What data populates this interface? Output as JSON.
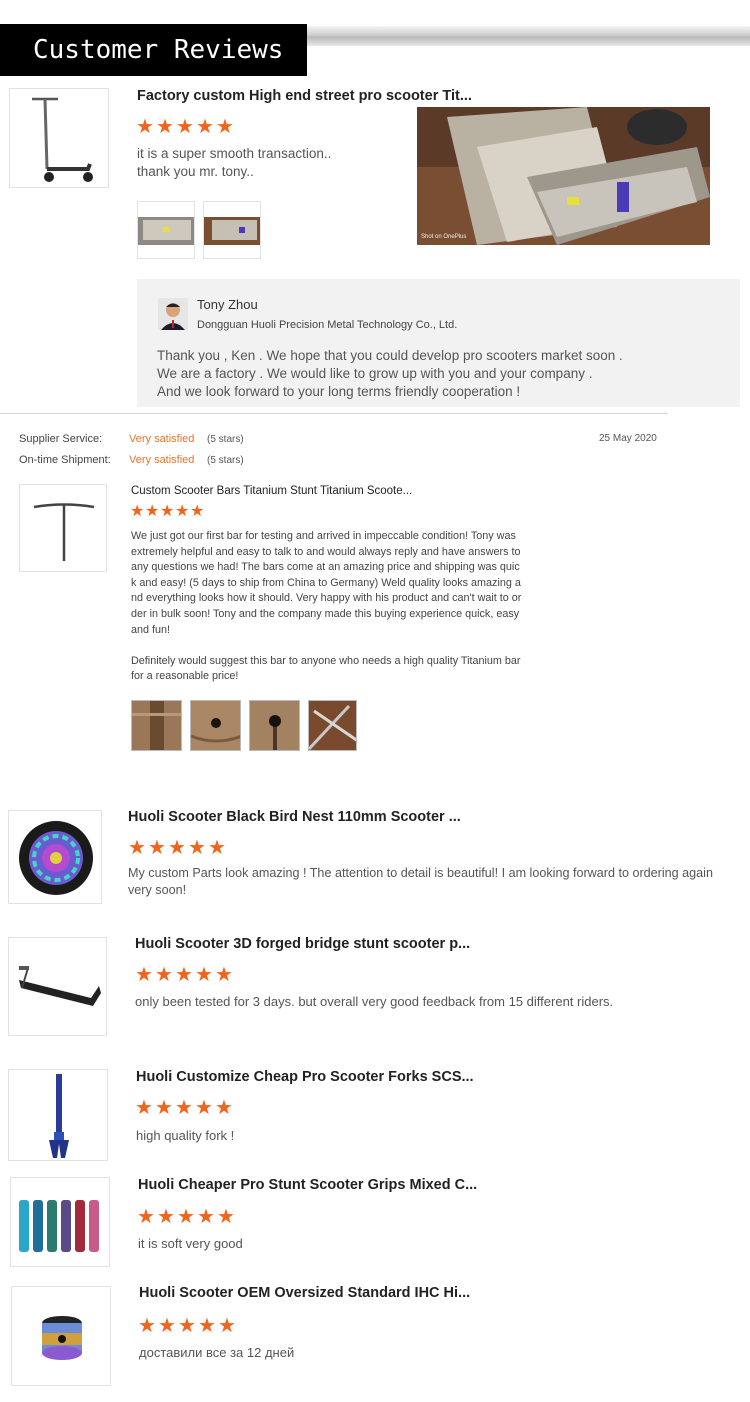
{
  "header": {
    "title": "Customer Reviews"
  },
  "review1": {
    "title": "Factory custom High end street pro scooter Tit...",
    "stars": 5,
    "text_line1": "it is a super smooth transaction..",
    "text_line2": "thank you mr. tony..",
    "photo_watermark": "Shot on OnePlus",
    "reply": {
      "name": "Tony Zhou",
      "company": "Dongguan Huoli Precision Metal Technology Co., Ltd.",
      "line1": "Thank you , Ken . We hope that you could develop pro scooters market soon .",
      "line2": "We are a factory . We would like to grow up with you and your company .",
      "line3": "And we look forward to your long terms friendly cooperation !"
    }
  },
  "review2": {
    "supplier_label": "Supplier Service:",
    "supplier_value": "Very satisfied",
    "supplier_stars": "(5 stars)",
    "shipment_label": "On-time Shipment:",
    "shipment_value": "Very satisfied",
    "shipment_stars": "(5 stars)",
    "date": "25 May 2020",
    "title": "Custom Scooter Bars Titanium Stunt Titanium Scoote...",
    "stars": 5,
    "lines": [
      "We just got our first bar for testing and arrived in impeccable condition! Tony was",
      "extremely helpful and easy to talk to and would always reply and have answers to",
      "any questions we had! The bars come at an amazing price and shipping was quic",
      "k and easy! (5 days to ship from China to Germany) Weld quality looks amazing a",
      "nd everything looks how it should. Very happy with his product and can't wait to or",
      "der in bulk soon! Tony and the company made this buying experience quick, easy",
      "and fun!"
    ],
    "lines2": [
      "Definitely would suggest this bar to anyone who needs a high quality Titanium bar",
      "for a reasonable price!"
    ]
  },
  "review3": {
    "title": "Huoli Scooter Black Bird Nest 110mm Scooter ...",
    "stars": 5,
    "line1": "My custom Parts look amazing ! The attention to detail is beautiful! I am looking forward to ordering again",
    "line2": "very soon!"
  },
  "review4": {
    "title": "Huoli Scooter 3D forged bridge stunt scooter p...",
    "stars": 5,
    "text": "only been tested for 3 days. but overall very good feedback from 15 different riders."
  },
  "review5": {
    "title": "Huoli Customize Cheap Pro Scooter Forks SCS...",
    "stars": 5,
    "text": "high quality fork !"
  },
  "review6": {
    "title": "Huoli Cheaper Pro Stunt Scooter Grips Mixed C...",
    "stars": 5,
    "text": "it is soft very good"
  },
  "review7": {
    "title": "Huoli Scooter OEM Oversized Standard IHC Hi...",
    "stars": 5,
    "text": "доставили все за 12 дней"
  },
  "colors": {
    "star": "#f2631c",
    "satisfied": "#e8742a",
    "reply_bg": "#f2f2f2"
  }
}
